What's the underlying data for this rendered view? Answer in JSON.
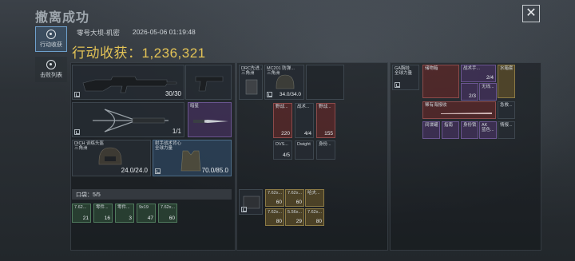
{
  "header": {
    "title": "撤离成功",
    "close_symbol": "✕"
  },
  "tabs": [
    {
      "label": "行动收获"
    },
    {
      "label": "击败列表"
    }
  ],
  "meta": {
    "map": "零号大坝-机密",
    "datetime": "2026-05-06 01:19:48"
  },
  "loot": {
    "label": "行动收获：",
    "value": "1,236,321"
  },
  "equipment": {
    "primary_ammo": "30/30",
    "secondary_count": "1/1",
    "melee_name": "暗星",
    "helmet_name": "DICH 训练头盔\n三角洲",
    "helmet_dur": "24.0/24.0",
    "armor_name": "射手战术背心\n全球力量",
    "armor_dur": "70.0/85.0",
    "chest_name": "DRC先进...\n三角洲",
    "helmet2_name": "MC201 防弹...\n三角洲",
    "helmet2_dur": "34.0/34.0"
  },
  "rig": [
    {
      "name": "野战...",
      "count": "220"
    },
    {
      "name": "战术...",
      "count": "4/4"
    },
    {
      "name": "野战...",
      "count": "155"
    },
    {
      "name": "DVS...",
      "count": "4/5"
    },
    {
      "name": "Dwight",
      "count": ""
    },
    {
      "name": "身份...",
      "count": ""
    }
  ],
  "pouch": {
    "label": "口袋：",
    "count": "5/5"
  },
  "pouch_items": [
    {
      "name": "7.62...",
      "count": "21"
    },
    {
      "name": "零件...",
      "count": "16"
    },
    {
      "name": "零件...",
      "count": "3"
    },
    {
      "name": "9x19",
      "count": "47"
    },
    {
      "name": "7.62x...",
      "count": "60"
    }
  ],
  "backpack_items": [
    {
      "name": "7.62x...",
      "count": "60"
    },
    {
      "name": "7.62x...",
      "count": "60"
    },
    {
      "name": "哈夫...",
      "count": ""
    },
    {
      "name": "7.62x...",
      "count": "80"
    },
    {
      "name": "5.56x...",
      "count": "29"
    },
    {
      "name": "7.62x...",
      "count": "80"
    }
  ],
  "case": {
    "name": "GA胸挂\n全球力量"
  },
  "right_items": [
    {
      "name": "储物箱",
      "count": ""
    },
    {
      "name": "战术手...",
      "count": "2/4"
    },
    {
      "name": "水箱套",
      "count": ""
    },
    {
      "name": "",
      "count": "2/3"
    },
    {
      "name": "无线...",
      "count": ""
    },
    {
      "name": "稀有海报收",
      "count": ""
    },
    {
      "name": "急救...",
      "count": ""
    },
    {
      "name": "间谍罐",
      "count": ""
    },
    {
      "name": "指南",
      "count": ""
    },
    {
      "name": "身份锁",
      "count": ""
    },
    {
      "name": "AK\n蓝色...",
      "count": ""
    },
    {
      "name": "情报...",
      "count": ""
    }
  ]
}
